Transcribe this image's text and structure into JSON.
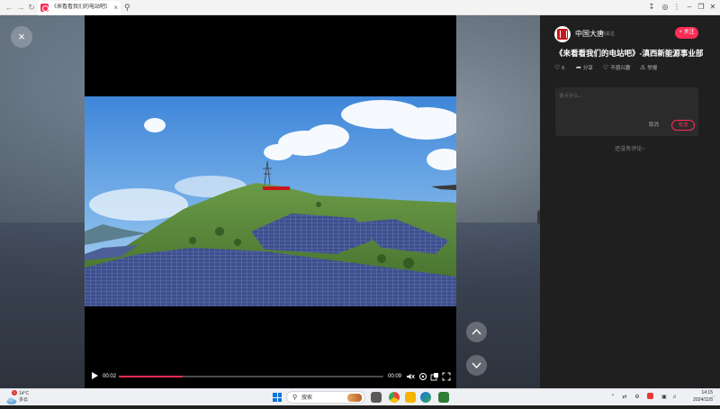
{
  "browser": {
    "tab_title": "《来看看我们的电站吧》-滇西...",
    "tab_close": "×",
    "new_tab": "+"
  },
  "player": {
    "close_glyph": "×",
    "time_current": "00:02",
    "time_total": "00:09",
    "progress": 0.24
  },
  "panel": {
    "author": "中国大唐",
    "fans": "3关注",
    "follow_label": "+ 关注",
    "video_title": "《来看看我们的电站吧》-滇西新能源事业部",
    "actions": {
      "like_count": "6",
      "share_label": "分享",
      "dislike_label": "不感兴趣",
      "report_label": "举报"
    },
    "comment": {
      "placeholder": "说点什么...",
      "cancel_label": "取消",
      "send_label": "发送"
    },
    "empty_comments": "还没有评论~"
  },
  "taskbar": {
    "weather_badge": "1",
    "temperature": "14°C",
    "weather_desc": "多云",
    "search_label": "搜索",
    "time": "14:15",
    "date": "2024/11/5"
  },
  "colors": {
    "accent": "#fe2c55",
    "panel_bg": "#1f1f1f",
    "taskbar_bg": "#eef0f4"
  }
}
